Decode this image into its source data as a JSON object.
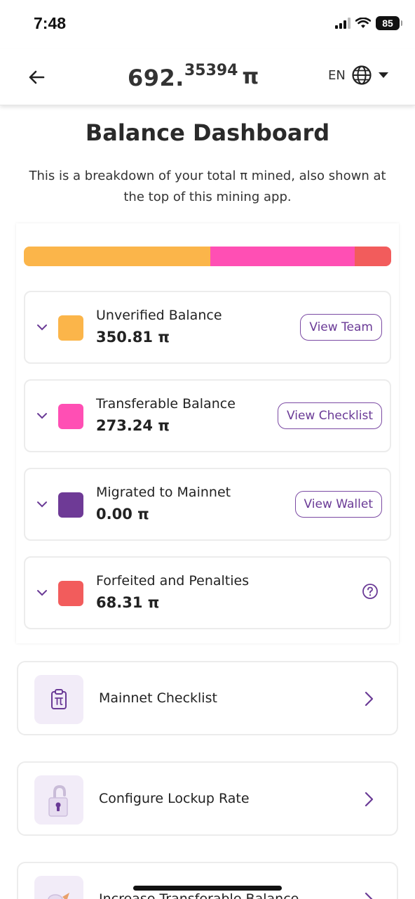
{
  "status_bar": {
    "time": "7:48",
    "battery": "85"
  },
  "header": {
    "balance_integer": "692.",
    "balance_decimal": "35394",
    "currency_symbol": "π",
    "language": "EN"
  },
  "title": "Balance Dashboard",
  "subtitle": "This is a breakdown of your total π mined, also shown at the top of this mining app.",
  "breakdown": {
    "progress_fractions": {
      "unverified": 0.507,
      "transferable": 0.394,
      "forfeited": 0.099
    },
    "rows": [
      {
        "label": "Unverified Balance",
        "value": "350.81 π",
        "color": "#FBB54A",
        "button": "View Team"
      },
      {
        "label": "Transferable Balance",
        "value": "273.24 π",
        "color": "#FF4FB4",
        "button": "View Checklist"
      },
      {
        "label": "Migrated to Mainnet",
        "value": "0.00 π",
        "color": "#6E3A96",
        "button": "View Wallet"
      },
      {
        "label": "Forfeited and Penalties",
        "value": "68.31 π",
        "color": "#F25C5C",
        "button": null
      }
    ]
  },
  "actions": [
    {
      "label": "Mainnet Checklist",
      "icon": "clipboard-pi-icon"
    },
    {
      "label": "Configure Lockup Rate",
      "icon": "padlock-icon"
    },
    {
      "label": "Increase Transferable Balance",
      "icon": "rocket-icon"
    }
  ],
  "colors": {
    "accent": "#6A3A96",
    "icon_bg": "#F2ECF8"
  }
}
